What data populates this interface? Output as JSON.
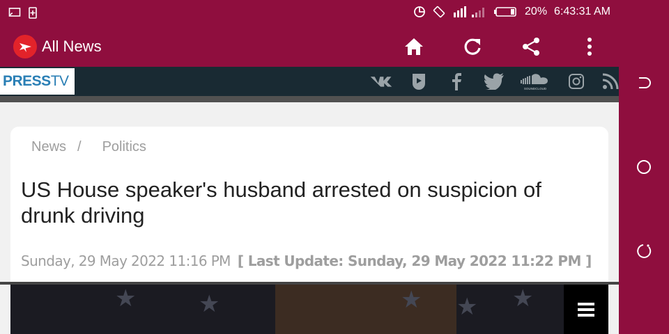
{
  "status_bar": {
    "battery_percent": "20%",
    "time": "6:43:31 AM"
  },
  "toolbar": {
    "title": "All News",
    "icons": [
      "home-icon",
      "refresh-icon",
      "share-icon",
      "more-vert-icon"
    ]
  },
  "site": {
    "logo_press": "PRESS",
    "logo_tv": "TV",
    "social": [
      "vk-icon",
      "bitchute-icon",
      "facebook-icon",
      "twitter-icon",
      "soundcloud-icon",
      "instagram-icon",
      "rss-icon"
    ],
    "soundcloud_label": "SOUNDCLOUD"
  },
  "article": {
    "breadcrumb": [
      "News",
      "Politics"
    ],
    "breadcrumb_separator": "/",
    "headline": "US House speaker's husband arrested on suspicion of drunk driving",
    "date": "Sunday, 29 May 2022 11:16 PM",
    "last_update": "[ Last Update: Sunday, 29 May 2022 11:22 PM ]"
  },
  "colors": {
    "brand": "#8f0e3e",
    "site_header": "#192a33",
    "logo_blue": "#2a7fb5"
  }
}
